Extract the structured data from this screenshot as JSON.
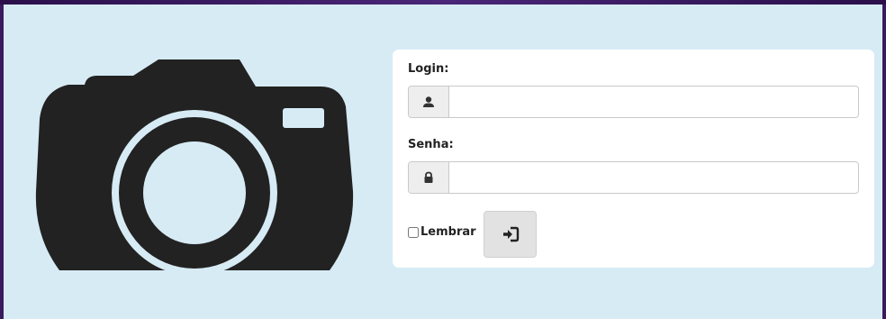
{
  "login_form": {
    "login_label": "Login:",
    "login_value": "",
    "password_label": "Senha:",
    "password_value": "",
    "remember_label": "Lembrar",
    "remember_checked": false,
    "submit_icon": "sign-in-icon"
  },
  "icons": {
    "logo": "camera-icon",
    "login_addon": "user-icon",
    "password_addon": "lock-icon"
  },
  "colors": {
    "background": "#d7ebf5",
    "border": "#3a1a5e",
    "panel": "#ffffff",
    "camera": "#222222"
  }
}
